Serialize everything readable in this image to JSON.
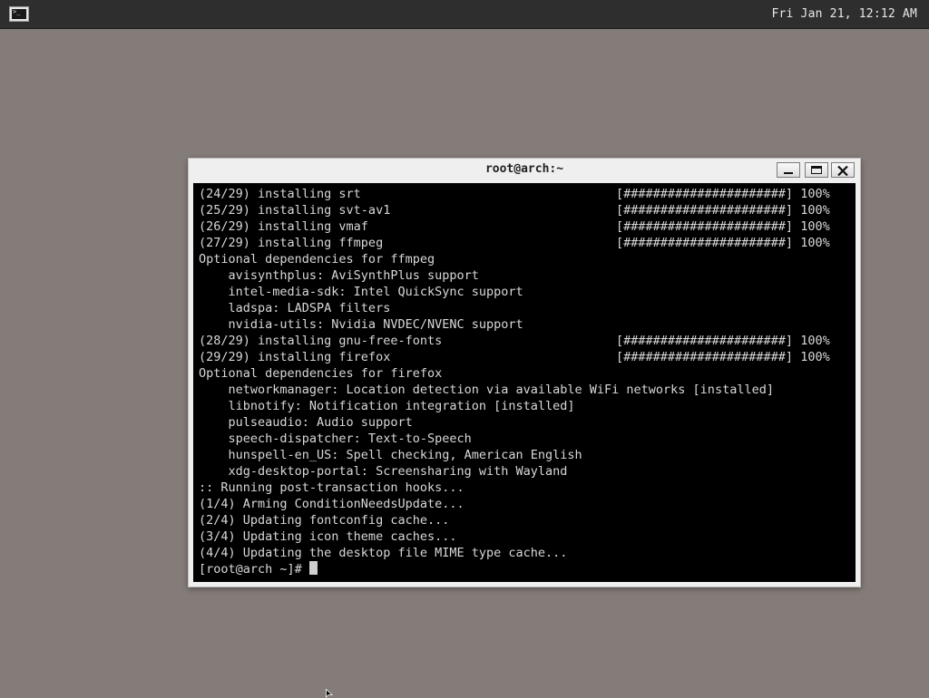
{
  "panel": {
    "launcher_glyph": ">_",
    "clock": "Fri Jan 21, 12:12 AM"
  },
  "window": {
    "title": "root@arch:~",
    "buttons": {
      "minimize": "minimize",
      "maximize": "maximize",
      "close": "close"
    }
  },
  "terminal": {
    "lines": [
      {
        "text": "(24/29) installing srt",
        "bar": "[######################] 100%"
      },
      {
        "text": "(25/29) installing svt-av1",
        "bar": "[######################] 100%"
      },
      {
        "text": "(26/29) installing vmaf",
        "bar": "[######################] 100%"
      },
      {
        "text": "(27/29) installing ffmpeg",
        "bar": "[######################] 100%"
      },
      {
        "text": "Optional dependencies for ffmpeg",
        "bar": ""
      },
      {
        "text": "    avisynthplus: AviSynthPlus support",
        "bar": ""
      },
      {
        "text": "    intel-media-sdk: Intel QuickSync support",
        "bar": ""
      },
      {
        "text": "    ladspa: LADSPA filters",
        "bar": ""
      },
      {
        "text": "    nvidia-utils: Nvidia NVDEC/NVENC support",
        "bar": ""
      },
      {
        "text": "(28/29) installing gnu-free-fonts",
        "bar": "[######################] 100%"
      },
      {
        "text": "(29/29) installing firefox",
        "bar": "[######################] 100%"
      },
      {
        "text": "Optional dependencies for firefox",
        "bar": ""
      },
      {
        "text": "    networkmanager: Location detection via available WiFi networks [installed]",
        "bar": ""
      },
      {
        "text": "    libnotify: Notification integration [installed]",
        "bar": ""
      },
      {
        "text": "    pulseaudio: Audio support",
        "bar": ""
      },
      {
        "text": "    speech-dispatcher: Text-to-Speech",
        "bar": ""
      },
      {
        "text": "    hunspell-en_US: Spell checking, American English",
        "bar": ""
      },
      {
        "text": "    xdg-desktop-portal: Screensharing with Wayland",
        "bar": ""
      },
      {
        "text": ":: Running post-transaction hooks...",
        "bar": ""
      },
      {
        "text": "(1/4) Arming ConditionNeedsUpdate...",
        "bar": ""
      },
      {
        "text": "(2/4) Updating fontconfig cache...",
        "bar": ""
      },
      {
        "text": "(3/4) Updating icon theme caches...",
        "bar": ""
      },
      {
        "text": "(4/4) Updating the desktop file MIME type cache...",
        "bar": ""
      }
    ],
    "prompt": "[root@arch ~]# "
  }
}
